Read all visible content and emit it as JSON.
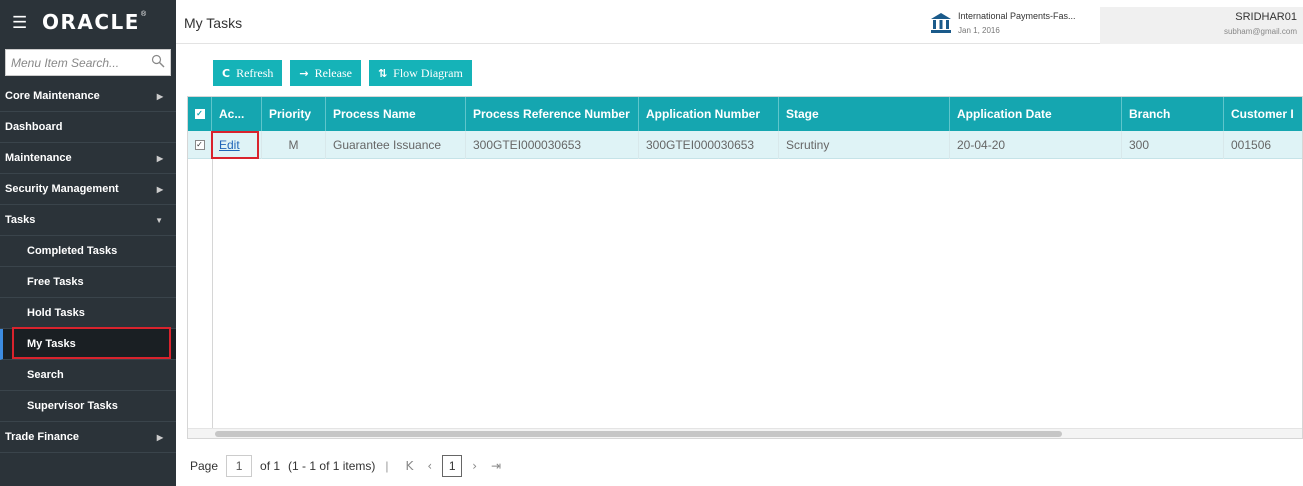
{
  "header": {
    "brand": "ORACLE",
    "brand_mark": "®",
    "page_title": "My Tasks",
    "entity_name": "International Payments-Fas...",
    "entity_date": "Jan 1, 2016",
    "user_name": "SRIDHAR01",
    "user_email": "subham@gmail.com"
  },
  "sidebar": {
    "search_placeholder": "Menu Item Search...",
    "items": [
      {
        "label": "Core Maintenance",
        "arrow": "right"
      },
      {
        "label": "Dashboard",
        "arrow": ""
      },
      {
        "label": "Maintenance",
        "arrow": "right"
      },
      {
        "label": "Security Management",
        "arrow": "right"
      },
      {
        "label": "Tasks",
        "arrow": "down"
      },
      {
        "label": "Completed Tasks",
        "sub": true
      },
      {
        "label": "Free Tasks",
        "sub": true
      },
      {
        "label": "Hold Tasks",
        "sub": true
      },
      {
        "label": "My Tasks",
        "sub": true,
        "active": true
      },
      {
        "label": "Search",
        "sub": true
      },
      {
        "label": "Supervisor Tasks",
        "sub": true
      },
      {
        "label": "Trade Finance",
        "arrow": "right"
      }
    ]
  },
  "toolbar": {
    "refresh_label": "Refresh",
    "release_label": "Release",
    "flow_label": "Flow Diagram"
  },
  "grid": {
    "columns": [
      "Ac...",
      "Priority",
      "Process Name",
      "Process Reference Number",
      "Application Number",
      "Stage",
      "Application Date",
      "Branch",
      "Customer I"
    ],
    "row": {
      "action": "Edit",
      "priority": "M",
      "process_name": "Guarantee Issuance",
      "process_ref": "300GTEI000030653",
      "application_number": "300GTEI000030653",
      "stage": "Scrutiny",
      "application_date": "20-04-20",
      "branch": "300",
      "customer": "001506"
    }
  },
  "pager": {
    "page_label": "Page",
    "page_value": "1",
    "of_label": "of 1",
    "items_label": "(1 - 1 of 1 items)",
    "current": "1"
  },
  "colors": {
    "sidebar_bg": "#2b3339",
    "accent": "#15b3b8",
    "grid_header": "#15a6b0",
    "highlight": "#d9232d"
  }
}
